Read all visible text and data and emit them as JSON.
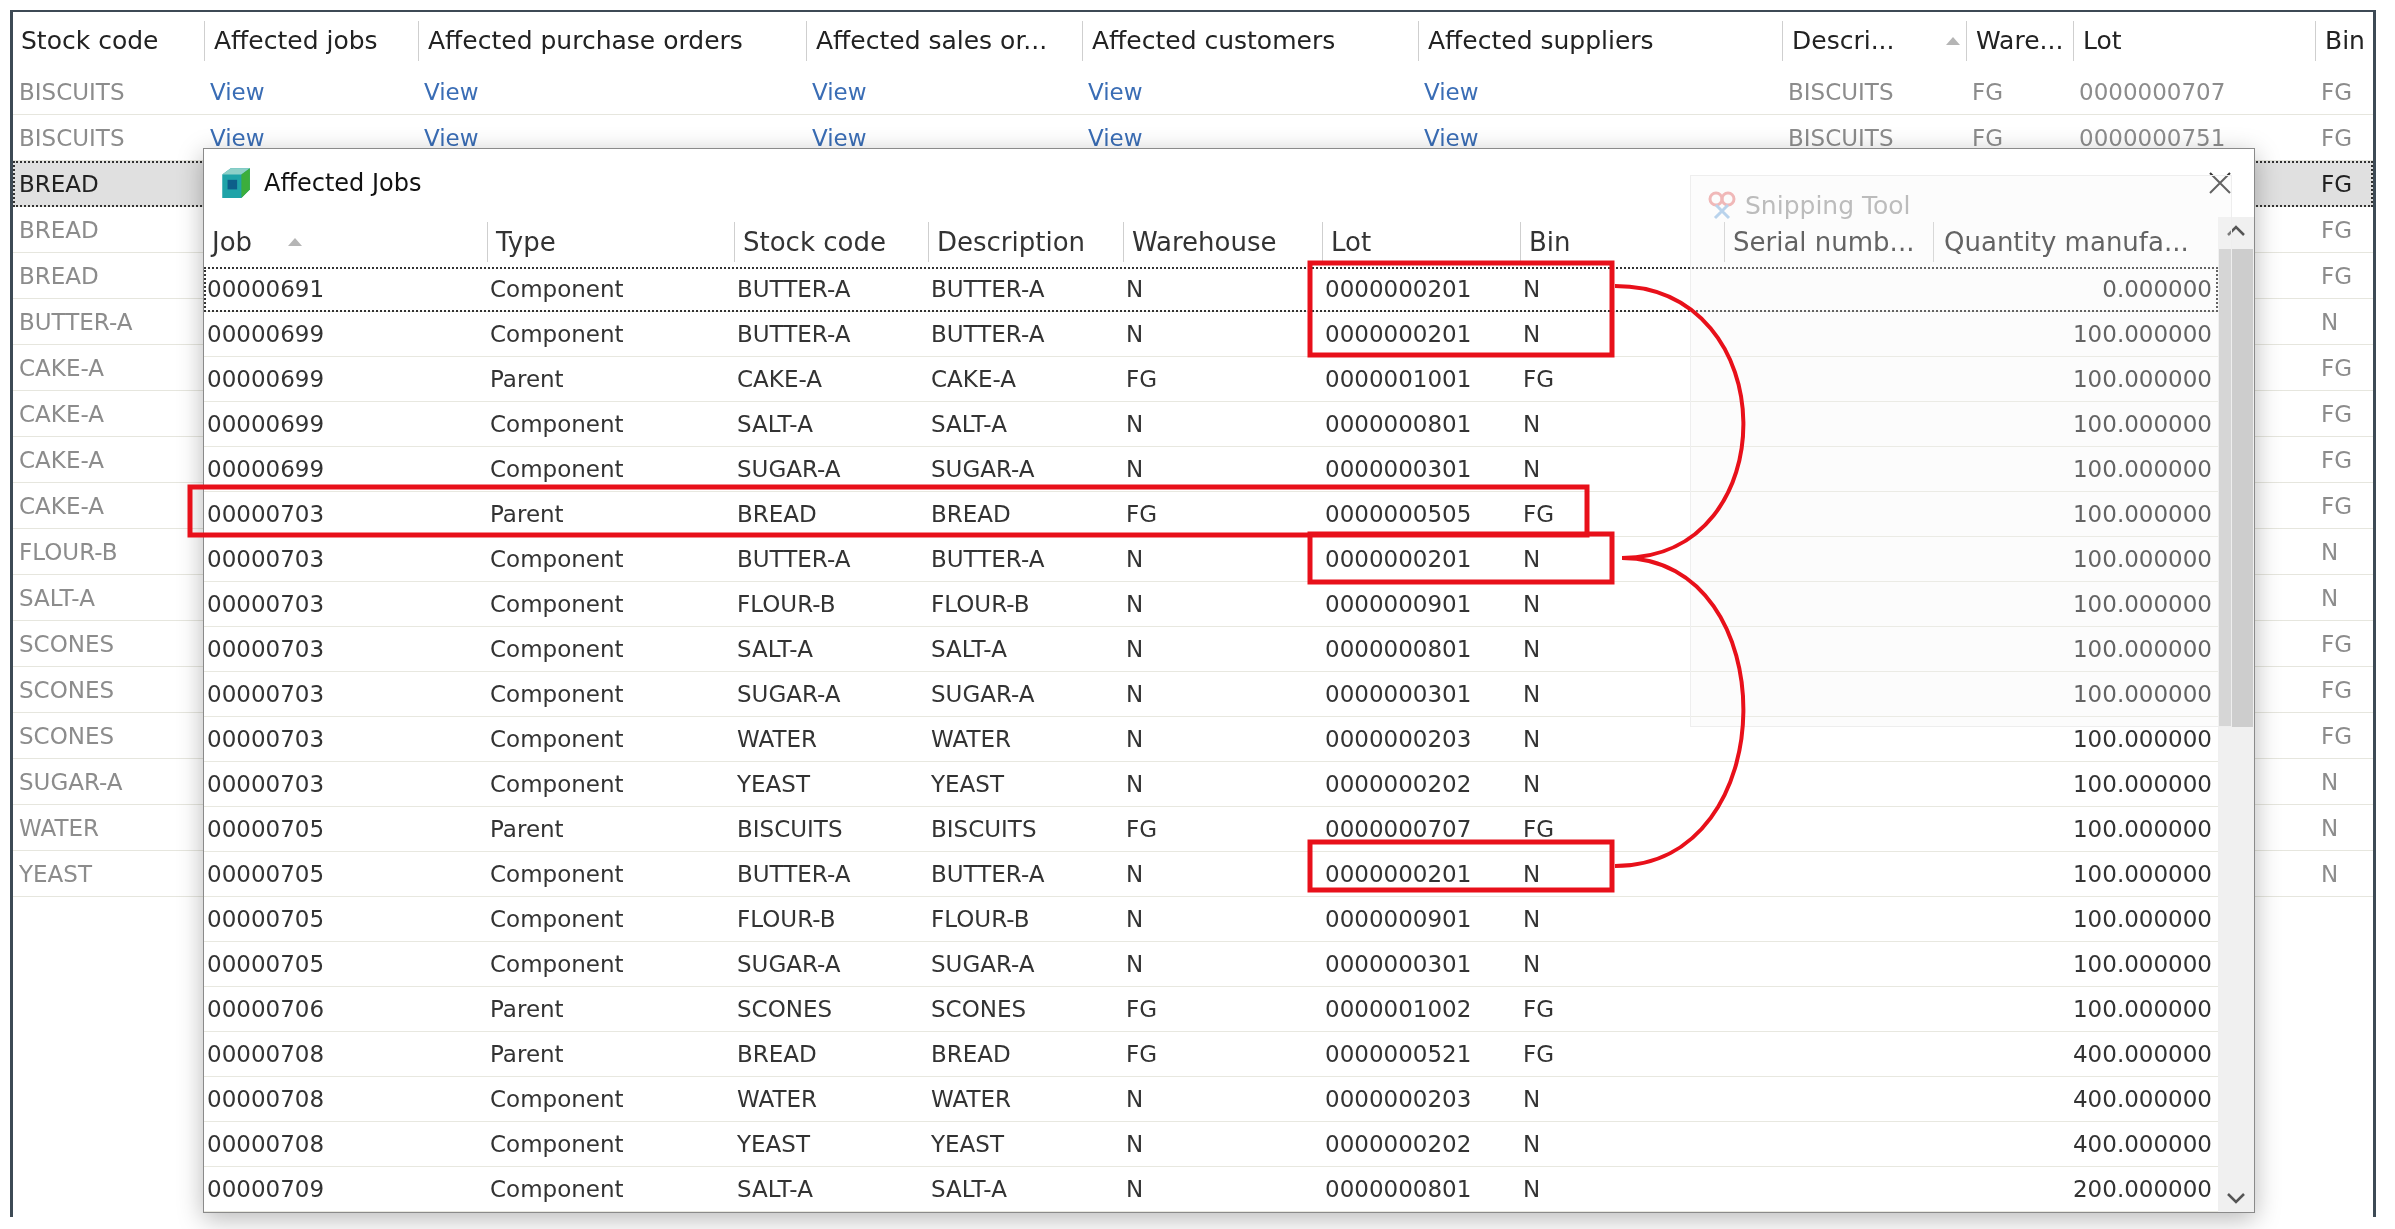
{
  "main_table": {
    "columns": [
      {
        "label": "Stock code",
        "kind": "text",
        "sorted": false
      },
      {
        "label": "Affected jobs",
        "kind": "link",
        "sorted": false
      },
      {
        "label": "Affected purchase orders",
        "kind": "link",
        "sorted": false
      },
      {
        "label": "Affected sales or...",
        "kind": "link",
        "sorted": false
      },
      {
        "label": "Affected customers",
        "kind": "link",
        "sorted": false
      },
      {
        "label": "Affected suppliers",
        "kind": "link",
        "sorted": false
      },
      {
        "label": "Descri...",
        "kind": "text",
        "sorted": true
      },
      {
        "label": "Ware...",
        "kind": "text",
        "sorted": false
      },
      {
        "label": "Lot",
        "kind": "text",
        "sorted": false
      },
      {
        "label": "Bin",
        "kind": "text",
        "sorted": false
      }
    ],
    "rows": [
      {
        "selected": false,
        "cells": [
          "BISCUITS",
          "View",
          "View",
          "View",
          "View",
          "View",
          "BISCUITS",
          "FG",
          "0000000707",
          "FG"
        ]
      },
      {
        "selected": false,
        "cells": [
          "BISCUITS",
          "View",
          "View",
          "View",
          "View",
          "View",
          "BISCUITS",
          "FG",
          "0000000751",
          "FG"
        ]
      },
      {
        "selected": true,
        "cells": [
          "BREAD",
          null,
          null,
          null,
          null,
          null,
          null,
          null,
          null,
          "FG"
        ]
      },
      {
        "selected": false,
        "cells": [
          "BREAD",
          null,
          null,
          null,
          null,
          null,
          null,
          null,
          null,
          "FG"
        ]
      },
      {
        "selected": false,
        "cells": [
          "BREAD",
          null,
          null,
          null,
          null,
          null,
          null,
          null,
          null,
          "FG"
        ]
      },
      {
        "selected": false,
        "cells": [
          "BUTTER-A",
          null,
          null,
          null,
          null,
          null,
          null,
          null,
          null,
          "N"
        ]
      },
      {
        "selected": false,
        "cells": [
          "CAKE-A",
          null,
          null,
          null,
          null,
          null,
          null,
          null,
          null,
          "FG"
        ]
      },
      {
        "selected": false,
        "cells": [
          "CAKE-A",
          null,
          null,
          null,
          null,
          null,
          null,
          null,
          null,
          "FG"
        ]
      },
      {
        "selected": false,
        "cells": [
          "CAKE-A",
          null,
          null,
          null,
          null,
          null,
          null,
          null,
          null,
          "FG"
        ]
      },
      {
        "selected": false,
        "cells": [
          "CAKE-A",
          null,
          null,
          null,
          null,
          null,
          null,
          null,
          null,
          "FG"
        ]
      },
      {
        "selected": false,
        "cells": [
          "FLOUR-B",
          null,
          null,
          null,
          null,
          null,
          null,
          null,
          null,
          "N"
        ]
      },
      {
        "selected": false,
        "cells": [
          "SALT-A",
          null,
          null,
          null,
          null,
          null,
          null,
          null,
          null,
          "N"
        ]
      },
      {
        "selected": false,
        "cells": [
          "SCONES",
          null,
          null,
          null,
          null,
          null,
          null,
          null,
          null,
          "FG"
        ]
      },
      {
        "selected": false,
        "cells": [
          "SCONES",
          null,
          null,
          null,
          null,
          null,
          null,
          null,
          null,
          "FG"
        ]
      },
      {
        "selected": false,
        "cells": [
          "SCONES",
          null,
          null,
          null,
          null,
          null,
          null,
          null,
          null,
          "FG"
        ]
      },
      {
        "selected": false,
        "cells": [
          "SUGAR-A",
          null,
          null,
          null,
          null,
          null,
          null,
          null,
          null,
          "N"
        ]
      },
      {
        "selected": false,
        "cells": [
          "WATER",
          null,
          null,
          null,
          null,
          null,
          null,
          null,
          null,
          "N"
        ]
      },
      {
        "selected": false,
        "cells": [
          "YEAST",
          null,
          null,
          null,
          null,
          null,
          null,
          null,
          null,
          "N"
        ]
      }
    ]
  },
  "dialog": {
    "title": "Affected Jobs",
    "columns": [
      {
        "label": "Job",
        "kind": "text",
        "sorted": true
      },
      {
        "label": "Type",
        "kind": "text",
        "sorted": false
      },
      {
        "label": "Stock code",
        "kind": "text",
        "sorted": false
      },
      {
        "label": "Description",
        "kind": "text",
        "sorted": false
      },
      {
        "label": "Warehouse",
        "kind": "text",
        "sorted": false
      },
      {
        "label": "Lot",
        "kind": "text",
        "sorted": false
      },
      {
        "label": "Bin",
        "kind": "text",
        "sorted": false
      },
      {
        "label": "Serial numb...",
        "kind": "text",
        "sorted": false
      },
      {
        "label": "Quantity manufa...",
        "kind": "number",
        "sorted": false
      }
    ],
    "rows": [
      {
        "selected": true,
        "cells": [
          "00000691",
          "Component",
          "BUTTER-A",
          "BUTTER-A",
          "N",
          "0000000201",
          "N",
          null,
          "0.000000"
        ]
      },
      {
        "selected": false,
        "cells": [
          "00000699",
          "Component",
          "BUTTER-A",
          "BUTTER-A",
          "N",
          "0000000201",
          "N",
          null,
          "100.000000"
        ]
      },
      {
        "selected": false,
        "cells": [
          "00000699",
          "Parent",
          "CAKE-A",
          "CAKE-A",
          "FG",
          "0000001001",
          "FG",
          null,
          "100.000000"
        ]
      },
      {
        "selected": false,
        "cells": [
          "00000699",
          "Component",
          "SALT-A",
          "SALT-A",
          "N",
          "0000000801",
          "N",
          null,
          "100.000000"
        ]
      },
      {
        "selected": false,
        "cells": [
          "00000699",
          "Component",
          "SUGAR-A",
          "SUGAR-A",
          "N",
          "0000000301",
          "N",
          null,
          "100.000000"
        ]
      },
      {
        "selected": false,
        "cells": [
          "00000703",
          "Parent",
          "BREAD",
          "BREAD",
          "FG",
          "0000000505",
          "FG",
          null,
          "100.000000"
        ]
      },
      {
        "selected": false,
        "cells": [
          "00000703",
          "Component",
          "BUTTER-A",
          "BUTTER-A",
          "N",
          "0000000201",
          "N",
          null,
          "100.000000"
        ]
      },
      {
        "selected": false,
        "cells": [
          "00000703",
          "Component",
          "FLOUR-B",
          "FLOUR-B",
          "N",
          "0000000901",
          "N",
          null,
          "100.000000"
        ]
      },
      {
        "selected": false,
        "cells": [
          "00000703",
          "Component",
          "SALT-A",
          "SALT-A",
          "N",
          "0000000801",
          "N",
          null,
          "100.000000"
        ]
      },
      {
        "selected": false,
        "cells": [
          "00000703",
          "Component",
          "SUGAR-A",
          "SUGAR-A",
          "N",
          "0000000301",
          "N",
          null,
          "100.000000"
        ]
      },
      {
        "selected": false,
        "cells": [
          "00000703",
          "Component",
          "WATER",
          "WATER",
          "N",
          "0000000203",
          "N",
          null,
          "100.000000"
        ]
      },
      {
        "selected": false,
        "cells": [
          "00000703",
          "Component",
          "YEAST",
          "YEAST",
          "N",
          "0000000202",
          "N",
          null,
          "100.000000"
        ]
      },
      {
        "selected": false,
        "cells": [
          "00000705",
          "Parent",
          "BISCUITS",
          "BISCUITS",
          "FG",
          "0000000707",
          "FG",
          null,
          "100.000000"
        ]
      },
      {
        "selected": false,
        "cells": [
          "00000705",
          "Component",
          "BUTTER-A",
          "BUTTER-A",
          "N",
          "0000000201",
          "N",
          null,
          "100.000000"
        ]
      },
      {
        "selected": false,
        "cells": [
          "00000705",
          "Component",
          "FLOUR-B",
          "FLOUR-B",
          "N",
          "0000000901",
          "N",
          null,
          "100.000000"
        ]
      },
      {
        "selected": false,
        "cells": [
          "00000705",
          "Component",
          "SUGAR-A",
          "SUGAR-A",
          "N",
          "0000000301",
          "N",
          null,
          "100.000000"
        ]
      },
      {
        "selected": false,
        "cells": [
          "00000706",
          "Parent",
          "SCONES",
          "SCONES",
          "FG",
          "0000001002",
          "FG",
          null,
          "100.000000"
        ]
      },
      {
        "selected": false,
        "cells": [
          "00000708",
          "Parent",
          "BREAD",
          "BREAD",
          "FG",
          "0000000521",
          "FG",
          null,
          "400.000000"
        ]
      },
      {
        "selected": false,
        "cells": [
          "00000708",
          "Component",
          "WATER",
          "WATER",
          "N",
          "0000000203",
          "N",
          null,
          "400.000000"
        ]
      },
      {
        "selected": false,
        "cells": [
          "00000708",
          "Component",
          "YEAST",
          "YEAST",
          "N",
          "0000000202",
          "N",
          null,
          "400.000000"
        ]
      },
      {
        "selected": false,
        "cells": [
          "00000709",
          "Component",
          "SALT-A",
          "SALT-A",
          "N",
          "0000000801",
          "N",
          null,
          "200.000000"
        ]
      }
    ]
  },
  "snipping_tool": {
    "title": "Snipping Tool"
  }
}
